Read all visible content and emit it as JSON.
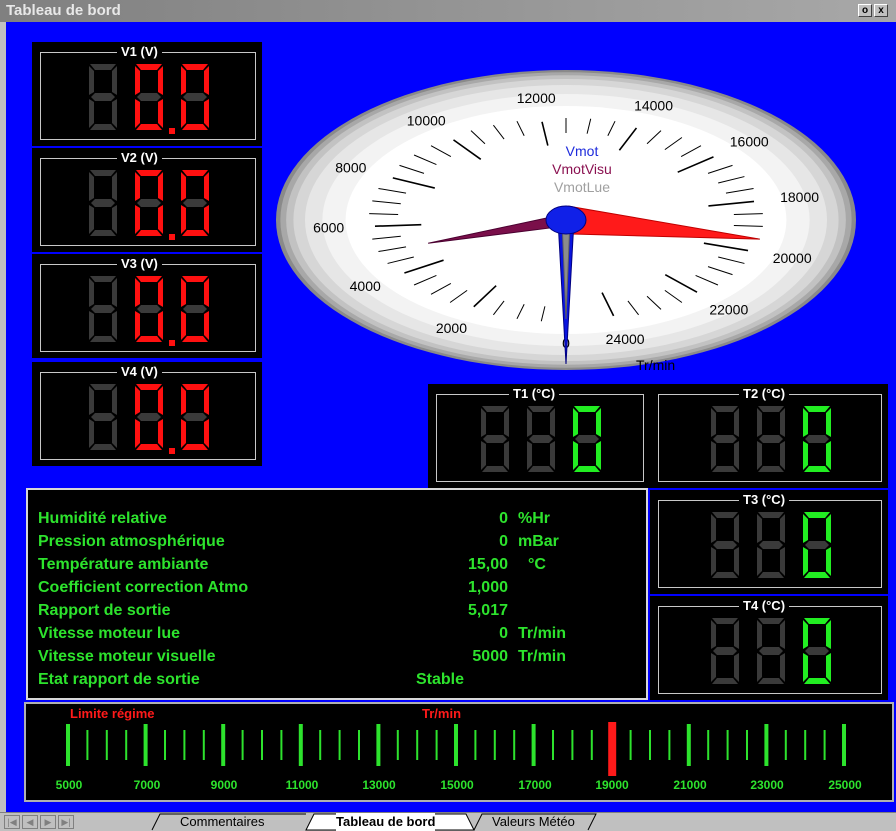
{
  "window": {
    "title": "Tableau de bord",
    "restore_glyph": "o",
    "close_glyph": "x"
  },
  "voltages": [
    {
      "label": "V1 (V)",
      "display": "0.0"
    },
    {
      "label": "V2 (V)",
      "display": "0.0"
    },
    {
      "label": "V3 (V)",
      "display": "0.0"
    },
    {
      "label": "V4 (V)",
      "display": "0.0"
    }
  ],
  "temperatures": [
    {
      "label": "T1 (°C)",
      "display": "0"
    },
    {
      "label": "T2 (°C)",
      "display": "0"
    },
    {
      "label": "T3 (°C)",
      "display": "0"
    },
    {
      "label": "T4 (°C)",
      "display": "0"
    }
  ],
  "gauge": {
    "scale_labels": [
      "0",
      "2000",
      "4000",
      "6000",
      "8000",
      "10000",
      "12000",
      "14000",
      "16000",
      "18000",
      "20000",
      "22000",
      "24000"
    ],
    "unit": "Tr/min",
    "legend": [
      {
        "name": "Vmot",
        "color": "#1e2bdc"
      },
      {
        "name": "VmotVisu",
        "color": "#8a1050"
      },
      {
        "name": "VmotLue",
        "color": "#a0a0a0"
      }
    ],
    "needles": {
      "Vmot": 19500,
      "VmotVisu": 5000,
      "VmotLue": 0
    }
  },
  "info": {
    "rows": [
      {
        "label": "Humidité relative",
        "value": "0",
        "unit": "%Hr"
      },
      {
        "label": "Pression atmosphérique",
        "value": "0",
        "unit": "mBar"
      },
      {
        "label": "Température ambiante",
        "value": "15,00",
        "unit": "°C"
      },
      {
        "label": "Coefficient correction Atmo",
        "value": "1,000",
        "unit": ""
      },
      {
        "label": "Rapport de sortie",
        "value": "5,017",
        "unit": ""
      },
      {
        "label": "Vitesse moteur lue",
        "value": "0",
        "unit": "Tr/min"
      },
      {
        "label": "Vitesse moteur visuelle",
        "value": "5000",
        "unit": "Tr/min"
      },
      {
        "label": "Etat rapport de sortie",
        "value": "Stable",
        "unit": ""
      }
    ]
  },
  "bargraph": {
    "limit_label": "Limite régime",
    "unit_label": "Tr/min",
    "tick_labels": [
      "5000",
      "7000",
      "9000",
      "11000",
      "13000",
      "15000",
      "17000",
      "19000",
      "21000",
      "23000",
      "25000"
    ],
    "range": [
      5000,
      25000
    ],
    "marker_value": 19000,
    "colors": {
      "ticks": "#2de32d",
      "marker": "#ff1a1a"
    }
  },
  "tabs": {
    "items": [
      "Commentaires",
      "Tableau de bord",
      "Valeurs Météo"
    ],
    "active": "Tableau de bord"
  },
  "colors": {
    "board": "#0000ff",
    "digit_on_red": "#ff1010",
    "digit_on_green": "#22ee22",
    "digit_off": "#3a3a3a"
  }
}
